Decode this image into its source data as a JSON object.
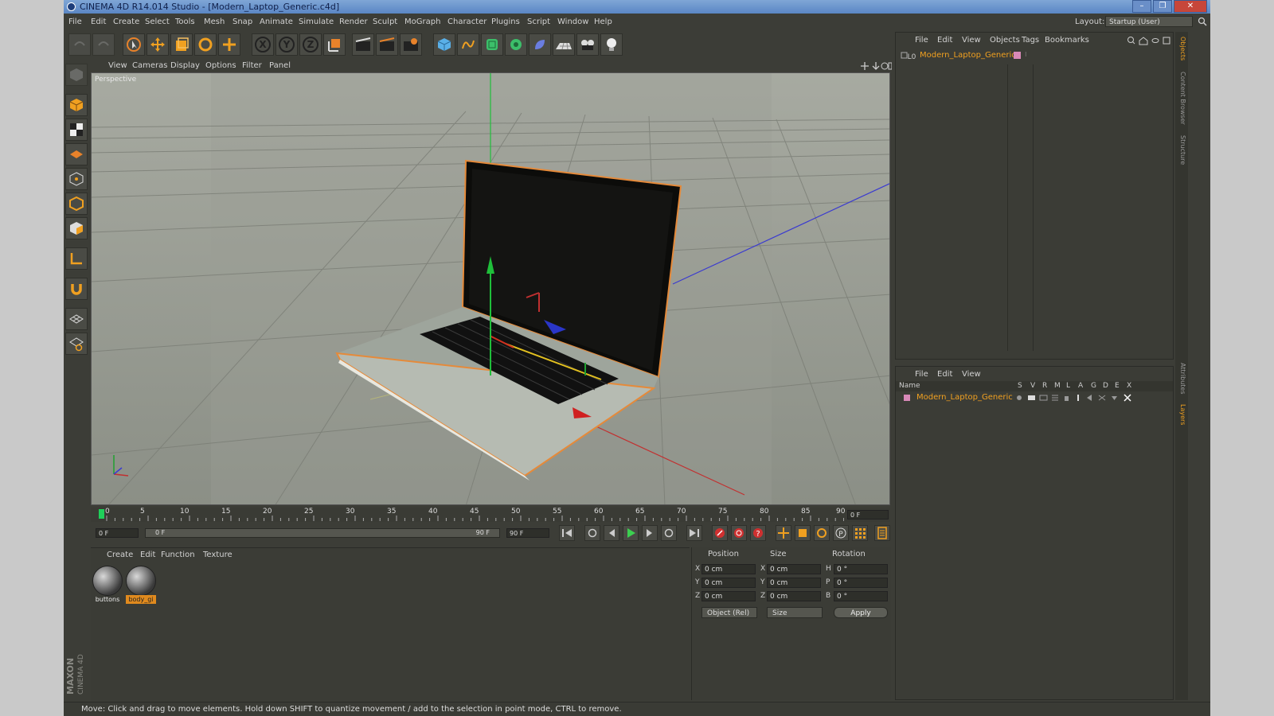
{
  "window": {
    "title": "CINEMA 4D R14.014 Studio - [Modern_Laptop_Generic.c4d]"
  },
  "menu": [
    "File",
    "Edit",
    "Create",
    "Select",
    "Tools",
    "Mesh",
    "Snap",
    "Animate",
    "Simulate",
    "Render",
    "Sculpt",
    "MoGraph",
    "Character",
    "Plugins",
    "Script",
    "Window",
    "Help"
  ],
  "layout": {
    "label": "Layout:",
    "value": "Startup (User)"
  },
  "viewport": {
    "menu": [
      "View",
      "Cameras",
      "Display",
      "Options",
      "Filter",
      "Panel"
    ],
    "label": "Perspective"
  },
  "timeline": {
    "ticks": [
      "0",
      "5",
      "10",
      "15",
      "20",
      "25",
      "30",
      "35",
      "40",
      "45",
      "50",
      "55",
      "60",
      "65",
      "70",
      "75",
      "80",
      "85",
      "90"
    ],
    "current_frame": "0 F",
    "start_field": "0 F",
    "range_start": "0 F",
    "range_end": "90 F",
    "end_field": "90 F"
  },
  "materials": {
    "menu": [
      "Create",
      "Edit",
      "Function",
      "Texture"
    ],
    "items": [
      {
        "label": "buttons",
        "selected": false
      },
      {
        "label": "body_gi",
        "selected": true
      }
    ]
  },
  "coordinates": {
    "headers": {
      "position": "Position",
      "size": "Size",
      "rotation": "Rotation"
    },
    "rows": [
      {
        "pos_axis": "X",
        "pos": "0 cm",
        "size_axis": "X",
        "size": "0 cm",
        "rot_axis": "H",
        "rot": "0 °"
      },
      {
        "pos_axis": "Y",
        "pos": "0 cm",
        "size_axis": "Y",
        "size": "0 cm",
        "rot_axis": "P",
        "rot": "0 °"
      },
      {
        "pos_axis": "Z",
        "pos": "0 cm",
        "size_axis": "Z",
        "size": "0 cm",
        "rot_axis": "B",
        "rot": "0 °"
      }
    ],
    "mode": "Object (Rel)",
    "size_mode": "Size",
    "apply": "Apply"
  },
  "object_manager": {
    "menu": [
      "File",
      "Edit",
      "View",
      "Objects",
      "Tags",
      "Bookmarks"
    ],
    "object": "Modern_Laptop_Generic"
  },
  "layer_manager": {
    "menu": [
      "File",
      "Edit",
      "View"
    ],
    "columns": [
      "Name",
      "S",
      "V",
      "R",
      "M",
      "L",
      "A",
      "G",
      "D",
      "E",
      "X"
    ],
    "layer": "Modern_Laptop_Generic"
  },
  "side_tabs": [
    "Objects",
    "Content Browser",
    "Structure",
    "Attributes",
    "Layers"
  ],
  "brand": {
    "line1": "MAXON",
    "line2": "CINEMA 4D"
  },
  "status": "Move: Click and drag to move elements. Hold down SHIFT to quantize movement / add to the selection in point mode, CTRL to remove.",
  "colors": {
    "accent": "#f0a020",
    "panel": "#3b3c36",
    "viewport": "#8f938a"
  }
}
